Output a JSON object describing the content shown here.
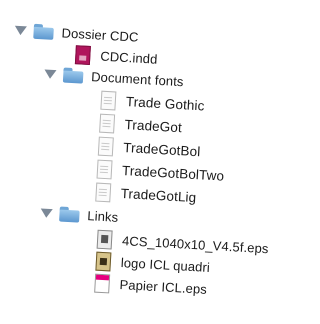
{
  "tree": {
    "root": {
      "label": "Dossier CDC",
      "expanded": true
    },
    "cdc_indd": {
      "label": "CDC.indd"
    },
    "document_fonts": {
      "label": "Document fonts",
      "expanded": true,
      "items": [
        {
          "label": "Trade Gothic"
        },
        {
          "label": "TradeGot"
        },
        {
          "label": "TradeGotBol"
        },
        {
          "label": "TradeGotBolTwo"
        },
        {
          "label": "TradeGotLig"
        }
      ]
    },
    "links": {
      "label": "Links",
      "expanded": true,
      "items": [
        {
          "label": "4CS_1040x10_V4.5f.eps"
        },
        {
          "label": "logo ICL quadri"
        },
        {
          "label": "Papier ICL.eps"
        }
      ]
    }
  },
  "colors": {
    "folder_blue": "#5c97cf",
    "indd_magenta": "#b0155c",
    "disclosure_gray": "#7b8897"
  },
  "icons": {
    "folder": "folder-icon",
    "indesign_file": "indesign-file-icon",
    "font_file": "font-file-icon",
    "eps_file": "eps-file-icon",
    "image_file": "image-file-icon"
  }
}
